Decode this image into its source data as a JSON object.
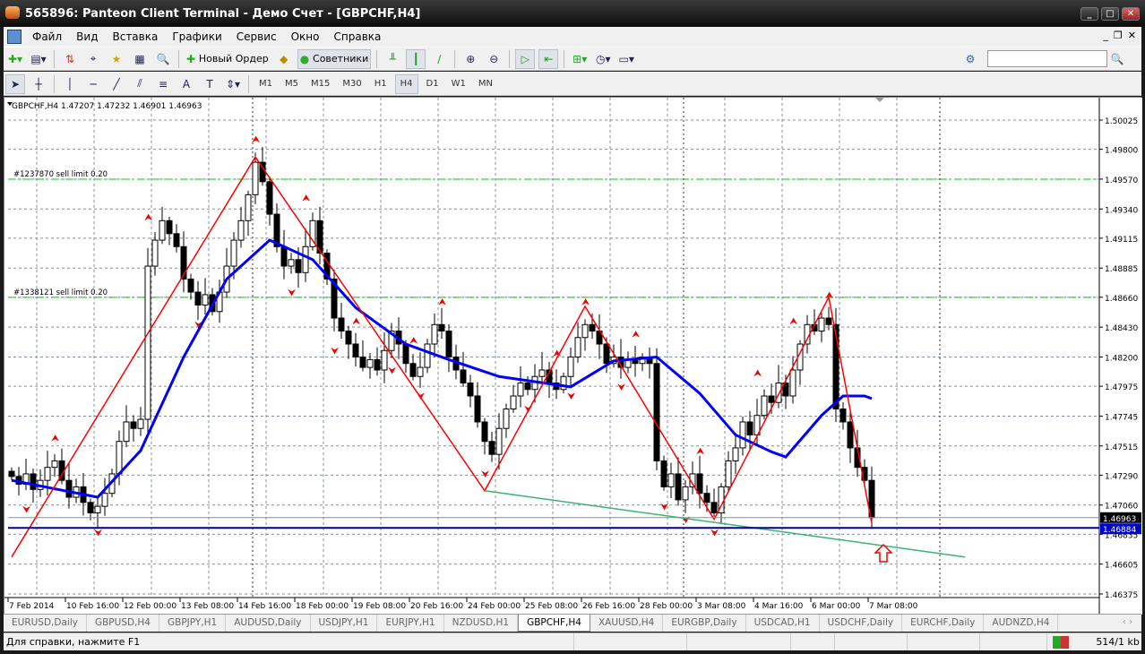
{
  "window": {
    "title": "565896: Panteon Client Terminal - Демо Счет - [GBPCHF,H4]"
  },
  "menu": [
    "Файл",
    "Вид",
    "Вставка",
    "Графики",
    "Сервис",
    "Окно",
    "Справка"
  ],
  "toolbar": {
    "new_order": "Новый Ордер",
    "experts": "Советники"
  },
  "timeframes": [
    "M1",
    "M5",
    "M15",
    "M30",
    "H1",
    "H4",
    "D1",
    "W1",
    "MN"
  ],
  "active_timeframe": "H4",
  "chart": {
    "header": "GBPCHF,H4  1.47207 1.47232 1.46901 1.46963",
    "orders": [
      {
        "label": "#1237870 sell limit 0.20",
        "price": 1.4957
      },
      {
        "label": "#1338121 sell limit 0.20",
        "price": 1.4866
      }
    ],
    "bid_label": "1.46963",
    "hline_label": "1.46884",
    "colors": {
      "zigzag": "#ff0000",
      "ma": "#0000ff",
      "trend": "#3cb371",
      "hline": "#00008b",
      "orders": "#00cc00"
    }
  },
  "chart_data": {
    "type": "candlestick",
    "symbol": "GBPCHF",
    "timeframe": "H4",
    "ylim": [
      1.46375,
      1.50025
    ],
    "y_ticks": [
      "1.50025",
      "1.49800",
      "1.49570",
      "1.49340",
      "1.49115",
      "1.48885",
      "1.48660",
      "1.48430",
      "1.48200",
      "1.47975",
      "1.47745",
      "1.47515",
      "1.47290",
      "1.47060",
      "1.46835",
      "1.46605",
      "1.46375"
    ],
    "x_ticks": [
      {
        "bar": 0,
        "label": "7 Feb 2014"
      },
      {
        "bar": 8,
        "label": "10 Feb 16:00"
      },
      {
        "bar": 16,
        "label": "12 Feb 00:00"
      },
      {
        "bar": 24,
        "label": "13 Feb 08:00"
      },
      {
        "bar": 32,
        "label": "14 Feb 16:00"
      },
      {
        "bar": 40,
        "label": "18 Feb 00:00"
      },
      {
        "bar": 48,
        "label": "19 Feb 08:00"
      },
      {
        "bar": 56,
        "label": "20 Feb 16:00"
      },
      {
        "bar": 64,
        "label": "24 Feb 00:00"
      },
      {
        "bar": 72,
        "label": "25 Feb 08:00"
      },
      {
        "bar": 80,
        "label": "26 Feb 16:00"
      },
      {
        "bar": 88,
        "label": "28 Feb 00:00"
      },
      {
        "bar": 96,
        "label": "3 Mar 08:00"
      },
      {
        "bar": 104,
        "label": "4 Mar 16:00"
      },
      {
        "bar": 112,
        "label": "6 Mar 00:00"
      },
      {
        "bar": 120,
        "label": "7 Mar 08:00"
      }
    ],
    "closes": [
      1.4728,
      1.4722,
      1.473,
      1.4718,
      1.4725,
      1.4735,
      1.474,
      1.4725,
      1.4712,
      1.472,
      1.4708,
      1.47,
      1.4705,
      1.4715,
      1.473,
      1.4755,
      1.477,
      1.4765,
      1.4772,
      1.489,
      1.491,
      1.4925,
      1.4915,
      1.4905,
      1.488,
      1.487,
      1.486,
      1.4868,
      1.4855,
      1.487,
      1.489,
      1.491,
      1.4925,
      1.4945,
      1.497,
      1.4955,
      1.493,
      1.4905,
      1.489,
      1.4895,
      1.4885,
      1.4905,
      1.4925,
      1.49,
      1.488,
      1.485,
      1.484,
      1.483,
      1.482,
      1.4812,
      1.4818,
      1.481,
      1.4825,
      1.484,
      1.483,
      1.4815,
      1.4805,
      1.4812,
      1.483,
      1.4845,
      1.484,
      1.482,
      1.481,
      1.48,
      1.479,
      1.477,
      1.4755,
      1.4745,
      1.4765,
      1.478,
      1.479,
      1.48,
      1.4795,
      1.4805,
      1.481,
      1.48,
      1.4795,
      1.4805,
      1.482,
      1.4835,
      1.4845,
      1.484,
      1.483,
      1.4815,
      1.482,
      1.4812,
      1.4818,
      1.4815,
      1.482,
      1.4815,
      1.474,
      1.472,
      1.473,
      1.471,
      1.472,
      1.473,
      1.4715,
      1.4708,
      1.47,
      1.472,
      1.474,
      1.475,
      1.477,
      1.476,
      1.4775,
      1.479,
      1.4785,
      1.48,
      1.479,
      1.481,
      1.483,
      1.4845,
      1.484,
      1.485,
      1.4845,
      1.478,
      1.477,
      1.475,
      1.4735,
      1.4725,
      1.46963
    ],
    "zigzag": [
      [
        0,
        1.4666
      ],
      [
        34,
        1.4974
      ],
      [
        66,
        1.4717
      ],
      [
        80,
        1.4859
      ],
      [
        98,
        1.4695
      ],
      [
        114,
        1.4866
      ],
      [
        120,
        1.4692
      ]
    ],
    "ma": [
      [
        0,
        1.4725
      ],
      [
        12,
        1.4712
      ],
      [
        18,
        1.4748
      ],
      [
        24,
        1.482
      ],
      [
        30,
        1.488
      ],
      [
        36,
        1.491
      ],
      [
        42,
        1.4895
      ],
      [
        48,
        1.4858
      ],
      [
        55,
        1.483
      ],
      [
        61,
        1.4818
      ],
      [
        68,
        1.4805
      ],
      [
        78,
        1.4797
      ],
      [
        84,
        1.4817
      ],
      [
        90,
        1.482
      ],
      [
        96,
        1.4792
      ],
      [
        101,
        1.476
      ],
      [
        106,
        1.4747
      ],
      [
        108,
        1.4743
      ],
      [
        113,
        1.4775
      ],
      [
        116,
        1.479
      ],
      [
        119,
        1.479
      ],
      [
        120,
        1.4788
      ]
    ],
    "trendline": [
      [
        66,
        1.4717
      ],
      [
        133,
        1.4666
      ]
    ],
    "hline": 1.46884,
    "fractals_up": [
      6,
      19,
      34,
      41,
      48,
      56,
      60,
      76,
      80,
      87,
      96,
      104,
      109,
      114
    ],
    "fractals_down": [
      2,
      12,
      26,
      39,
      45,
      53,
      57,
      66,
      72,
      78,
      85,
      91,
      94,
      98
    ],
    "signal_arrow_bar": 121
  },
  "tabs": [
    "EURUSD,Daily",
    "GBPUSD,H4",
    "GBPJPY,H1",
    "AUDUSD,Daily",
    "USDJPY,H1",
    "EURJPY,H1",
    "NZDUSD,H1",
    "GBPCHF,H4",
    "XAUUSD,H4",
    "EURGBP,Daily",
    "USDCAD,H1",
    "USDCHF,Daily",
    "EURCHF,Daily",
    "AUDNZD,H4"
  ],
  "active_tab": "GBPCHF,H4",
  "status": {
    "help": "Для справки, нажмите F1",
    "traffic": "514/1 kb"
  }
}
